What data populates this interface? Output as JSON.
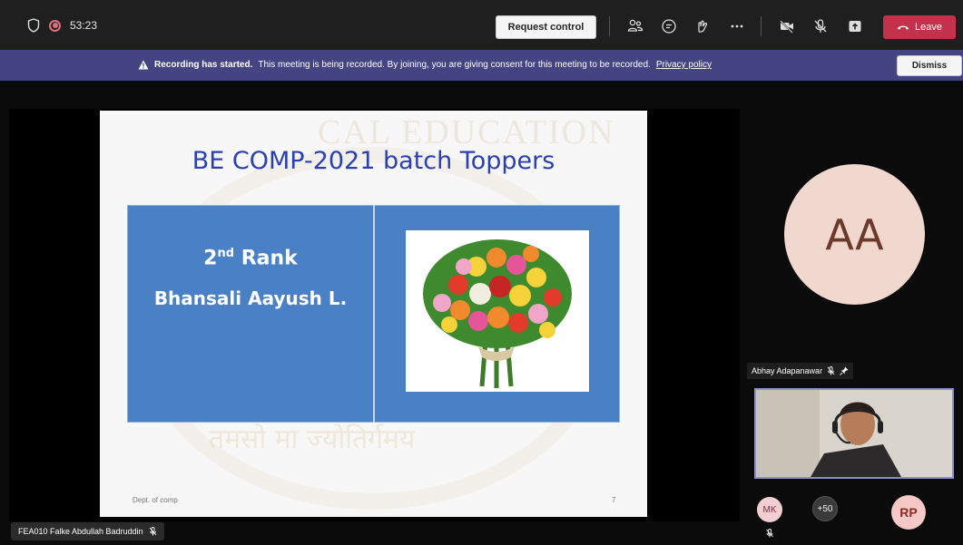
{
  "topbar": {
    "timer": "53:23",
    "request_control_label": "Request control",
    "leave_label": "Leave"
  },
  "banner": {
    "strong_text": "Recording has started.",
    "message": "This meeting is being recorded. By joining, you are giving consent for this meeting to be recorded.",
    "link_text": "Privacy policy",
    "dismiss_label": "Dismiss"
  },
  "slide": {
    "title": "BE COMP-2021 batch Toppers",
    "rank_number": "2",
    "rank_suffix": "nd",
    "rank_word": "Rank",
    "student_name": "Bhansali Aayush L.",
    "footer": "Dept. of comp",
    "page_number": "7",
    "watermark_top": "CAL EDUCATION",
    "watermark_bottom": "तमसो मा ज्योतिर्गमय"
  },
  "presenter": {
    "name": "FEA010 Falke Abdullah Badruddin"
  },
  "participants": {
    "featured_initials": "AA",
    "featured_name": "Abhay Adapanawar",
    "mini": [
      {
        "initials": "MK"
      },
      {
        "initials": "+50"
      },
      {
        "initials": "RP"
      }
    ]
  },
  "colors": {
    "leave": "#c4314b",
    "banner": "#434481",
    "slide_title": "#2a3fb2",
    "slide_table": "#4a80c6"
  }
}
